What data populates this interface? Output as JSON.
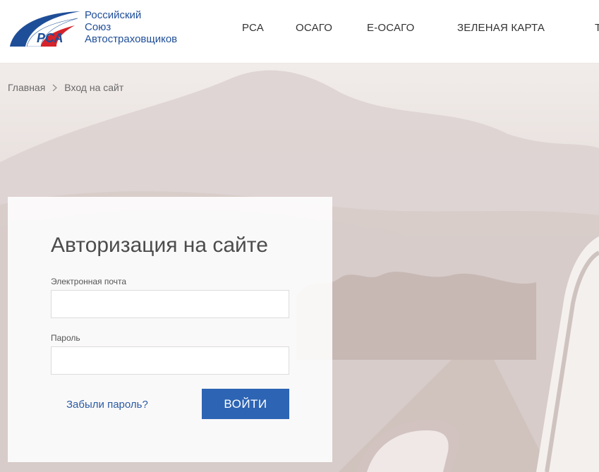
{
  "brand": {
    "logo_letters": "РСА",
    "name_lines": [
      "Российский",
      "Союз",
      "Автостраховщиков"
    ],
    "colors": {
      "blue": "#1f4e98",
      "red": "#d6232b"
    }
  },
  "nav": {
    "items": [
      "РСА",
      "ОСАГО",
      "Е-ОСАГО",
      "ЗЕЛЕНАЯ КАРТА"
    ],
    "partial_item": "Т"
  },
  "breadcrumb": {
    "home": "Главная",
    "current": "Вход на сайт",
    "separator_icon": "chevron-right-icon"
  },
  "login": {
    "title": "Авторизация на сайте",
    "email_label": "Электронная почта",
    "email_value": "",
    "password_label": "Пароль",
    "password_value": "",
    "forgot_label": "Забыли пароль?",
    "submit_label": "ВОЙТИ"
  },
  "colors": {
    "accent_button": "#2d64b4",
    "link": "#2a5aa5"
  }
}
